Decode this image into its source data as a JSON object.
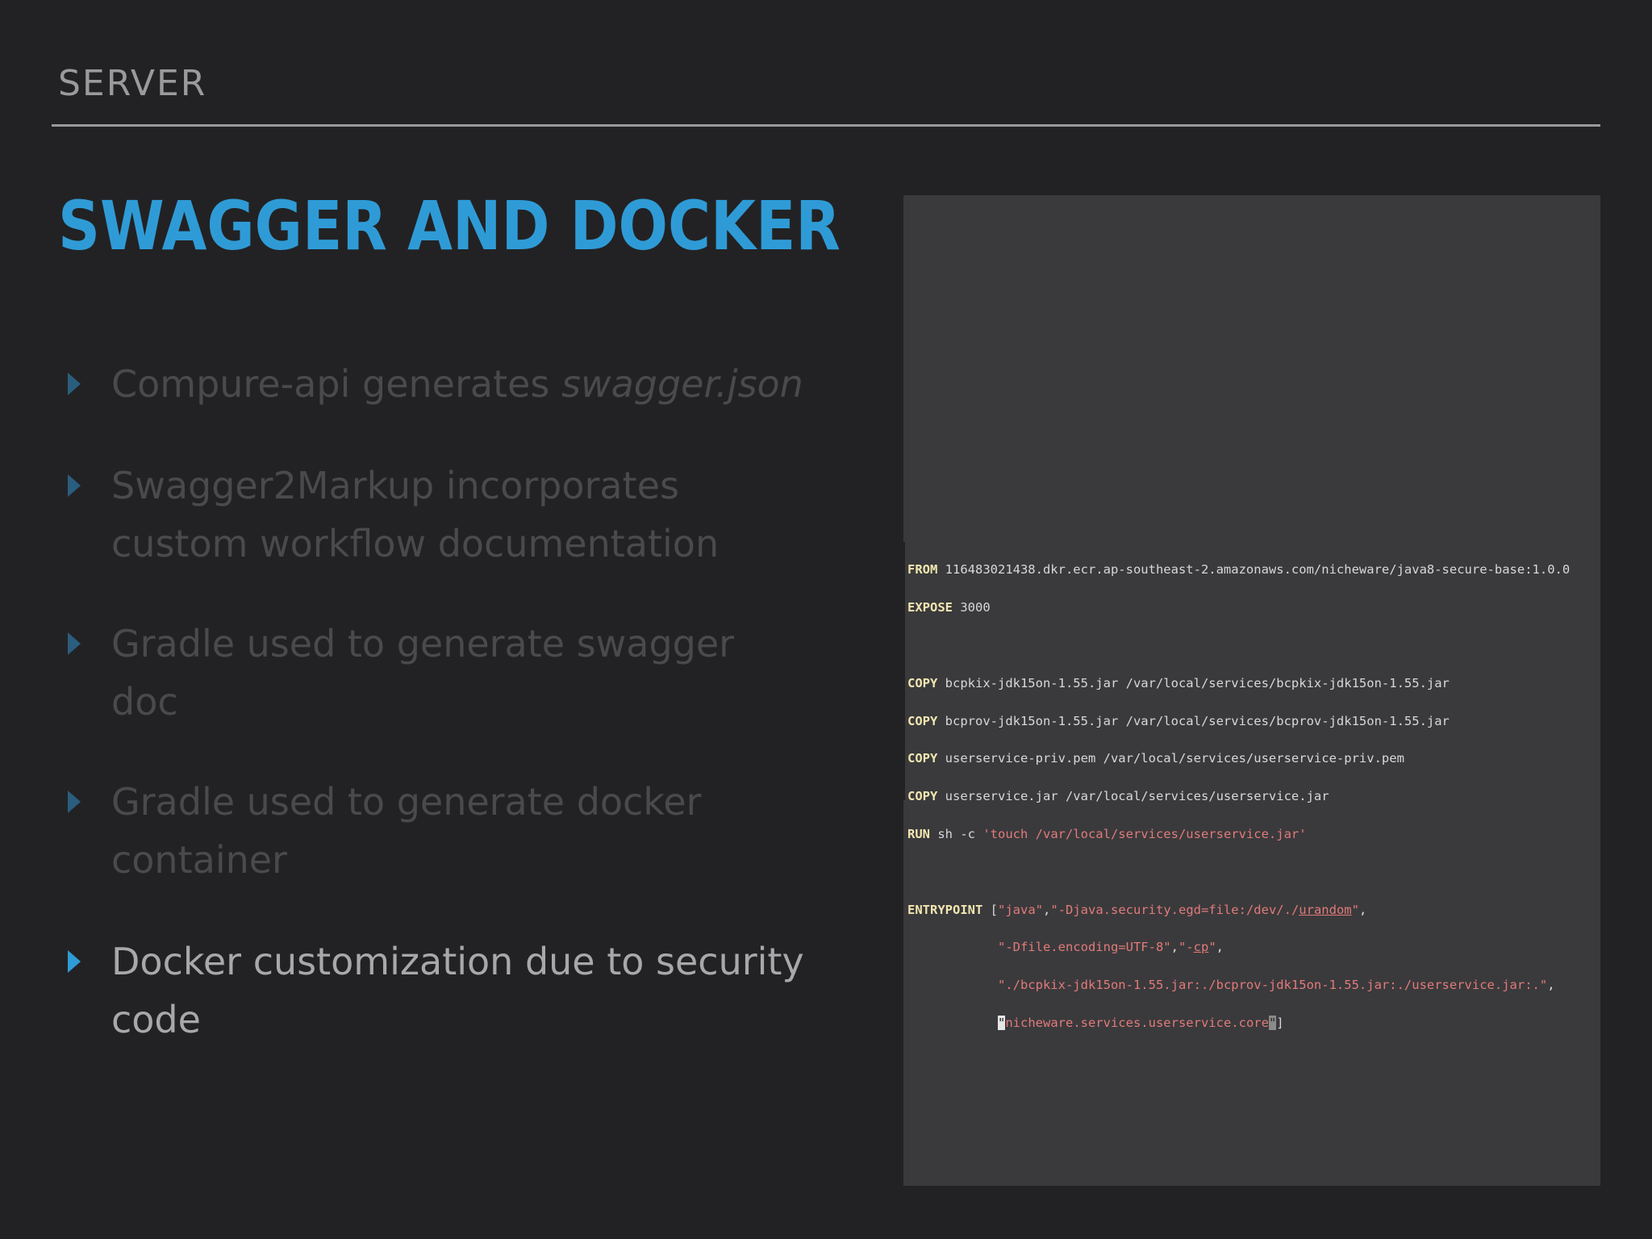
{
  "header": {
    "section_label": "SERVER"
  },
  "title": "SWAGGER AND DOCKER",
  "bullets": [
    {
      "text": "Compure-api generates ",
      "italic": "swagger.json",
      "active": false
    },
    {
      "line1": "Swagger2Markup incorporates",
      "line2": "custom workflow documentation",
      "active": false
    },
    {
      "line1": "Gradle used to generate swagger",
      "line2": "doc",
      "active": false
    },
    {
      "line1": "Gradle used to generate docker",
      "line2": "container",
      "active": false
    },
    {
      "line1": "Docker customization due to security",
      "line2": "code",
      "active": true
    }
  ],
  "dockerfile": {
    "from_kw": "FROM",
    "from_val": " 116483021438.dkr.ecr.ap-southeast-2.amazonaws.com/nicheware/java8-secure-base:1.0.0",
    "expose_kw": "EXPOSE",
    "expose_val": " 3000",
    "copy_kw": "COPY",
    "copy1": " bcpkix-jdk15on-1.55.jar /var/local/services/bcpkix-jdk15on-1.55.jar",
    "copy2": " bcprov-jdk15on-1.55.jar /var/local/services/bcprov-jdk15on-1.55.jar",
    "copy3": " userservice-priv.pem /var/local/services/userservice-priv.pem",
    "copy4": " userservice.jar /var/local/services/userservice.jar",
    "run_kw": "RUN",
    "run_cmd": " sh -c ",
    "run_str": "'touch /var/local/services/userservice.jar'",
    "entry_kw": "ENTRYPOINT",
    "entry_open": " [",
    "entry_s1": "\"java\"",
    "entry_comma1": ",",
    "entry_s2a": "\"-Djava.security.egd=file:/dev/./",
    "entry_s2u": "urandom",
    "entry_s2b": "\"",
    "entry_comma2": ",",
    "indent": "            ",
    "entry_s3": "\"-Dfile.encoding=UTF-8\"",
    "entry_comma3": ",",
    "entry_s4a": "\"-",
    "entry_s4u": "cp",
    "entry_s4b": "\"",
    "entry_comma4": ",",
    "entry_s5": "\"./bcpkix-jdk15on-1.55.jar:./bcprov-jdk15on-1.55.jar:./userservice.jar:.\"",
    "entry_comma5": ",",
    "entry_cursor": "\"",
    "entry_s6": "nicheware.services.userservice.core",
    "entry_cursor2": "\"",
    "entry_close": "]"
  }
}
